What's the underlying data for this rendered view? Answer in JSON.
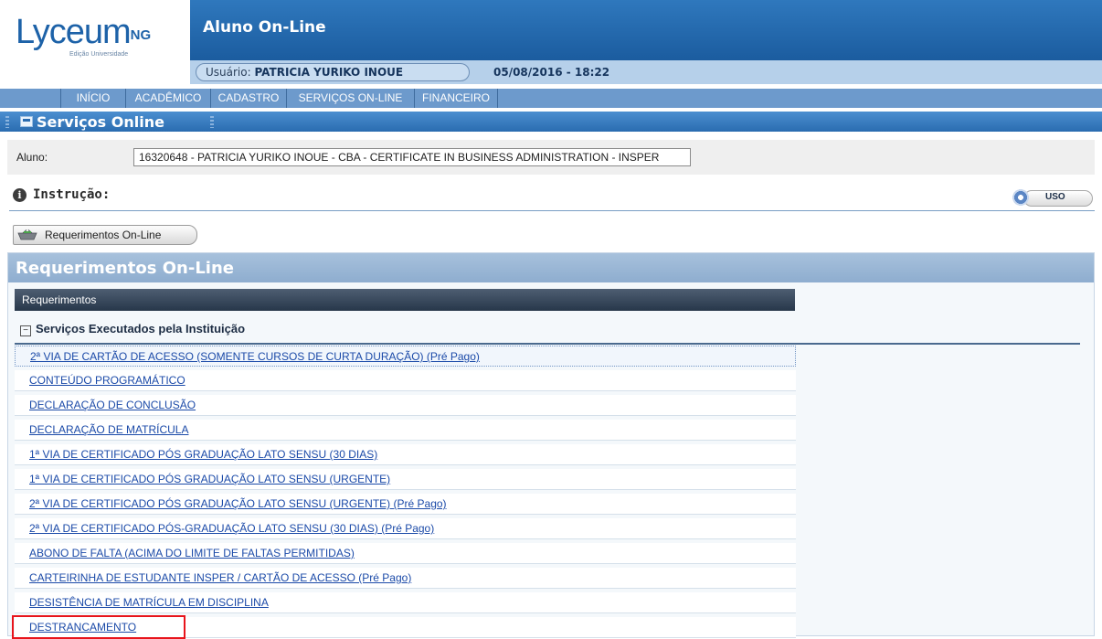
{
  "header": {
    "logo_main": "Lyceum",
    "logo_sup": "NG",
    "logo_sub": "Edição Universidade",
    "app_title": "Aluno On-Line",
    "user_label": "Usuário:",
    "user_name": "PATRICIA YURIKO INOUE",
    "datetime": "05/08/2016 - 18:22"
  },
  "nav": {
    "items": [
      "INÍCIO",
      "ACADÊMICO",
      "CADASTRO",
      "SERVIÇOS ON-LINE",
      "FINANCEIRO"
    ]
  },
  "section": {
    "title": "Serviços Online"
  },
  "aluno": {
    "label": "Aluno:",
    "value": "16320648 - PATRICIA YURIKO INOUE - CBA - CERTIFICATE IN BUSINESS ADMINISTRATION - INSPER"
  },
  "instrucao": {
    "title": "Instrução:",
    "uso_label": "USO"
  },
  "requerimentos_button": {
    "label": "Requerimentos On-Line"
  },
  "panel": {
    "title": "Requerimentos On-Line",
    "grid_header": "Requerimentos",
    "group_label": "Serviços Executados pela Instituição",
    "items": [
      "2ª VIA DE CARTÃO DE ACESSO (SOMENTE CURSOS DE CURTA DURAÇÃO) (Pré Pago)",
      "CONTEÚDO PROGRAMÁTICO",
      "DECLARAÇÃO DE CONCLUSÃO",
      "DECLARAÇÃO DE MATRÍCULA",
      "1ª VIA DE CERTIFICADO PÓS GRADUAÇÃO LATO SENSU (30 DIAS)",
      "1ª VIA DE CERTIFICADO PÓS GRADUAÇÃO LATO SENSU (URGENTE)",
      "2ª VIA DE CERTIFICADO PÓS GRADUAÇÃO LATO SENSU (URGENTE) (Pré Pago)",
      "2ª VIA DE CERTIFICADO PÓS-GRADUAÇÃO LATO SENSU (30 DIAS) (Pré Pago)",
      "ABONO DE FALTA (ACIMA DO LIMITE DE FALTAS PERMITIDAS)",
      "CARTEIRINHA DE ESTUDANTE INSPER / CARTÃO DE ACESSO (Pré Pago)",
      "DESISTÊNCIA DE MATRÍCULA EM DISCIPLINA",
      "DESTRANCAMENTO"
    ]
  },
  "colors": {
    "header_blue": "#1b5c9f",
    "nav_blue": "#6d9acc",
    "link_blue": "#1b4aa8",
    "highlight_red": "#e8141b"
  }
}
